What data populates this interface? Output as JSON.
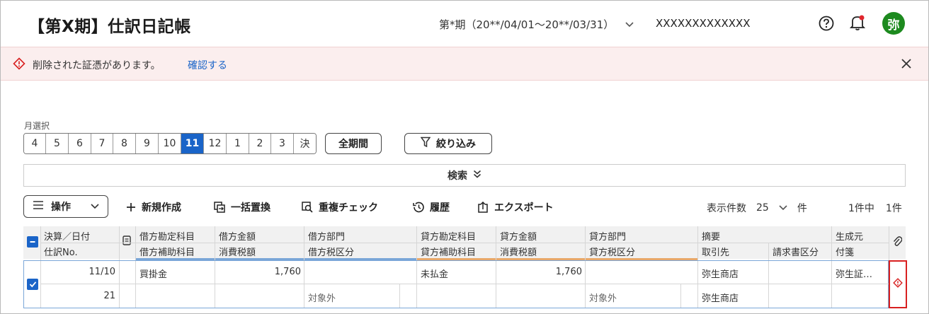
{
  "header": {
    "title": "【第X期】仕訳日記帳",
    "period": "第*期（20**/04/01〜20**/03/31）",
    "company": "XXXXXXXXXXXXX",
    "avatar": "弥"
  },
  "alert": {
    "message": "削除された証憑があります。",
    "link": "確認する"
  },
  "month_selector": {
    "label": "月選択",
    "months": [
      "4",
      "5",
      "6",
      "7",
      "8",
      "9",
      "10",
      "11",
      "12",
      "1",
      "2",
      "3",
      "決"
    ],
    "active": "11",
    "all_label": "全期間",
    "filter_label": "絞り込み"
  },
  "search": {
    "label": "検索"
  },
  "toolbar": {
    "ops": "操作",
    "new": "新規作成",
    "replace": "一括置換",
    "duplicate": "重複チェック",
    "history": "履歴",
    "export": "エクスポート",
    "page_size_label": "表示件数",
    "page_size": "25",
    "unit": "件",
    "total": "1件中",
    "count": "1件"
  },
  "table": {
    "headers_top": [
      "決算／日付",
      "借方勘定科目",
      "借方金額",
      "借方部門",
      "貸方勘定科目",
      "貸方金額",
      "貸方部門",
      "摘要",
      "生成元"
    ],
    "headers_bottom": [
      "仕訳No.",
      "借方補助科目",
      "消費税額",
      "借方税区分",
      "貸方補助科目",
      "消費税額",
      "貸方税区分",
      "取引先",
      "請求書区分",
      "付箋"
    ],
    "row": {
      "date": "11/10",
      "no": "21",
      "debit_account": "買掛金",
      "debit_amount": "1,760",
      "debit_tax": "対象外",
      "credit_account": "未払金",
      "credit_amount": "1,760",
      "credit_tax": "対象外",
      "summary": "弥生商店",
      "partner": "弥生商店",
      "source": "弥生証…"
    }
  },
  "colors": {
    "accent_blue": "#1a64c8",
    "debit_accent": "#7aa6d8",
    "credit_accent": "#e8a86a",
    "alert_bg": "#fbeeee",
    "warning_red": "#d82020",
    "avatar_green": "#1d8a1f"
  }
}
